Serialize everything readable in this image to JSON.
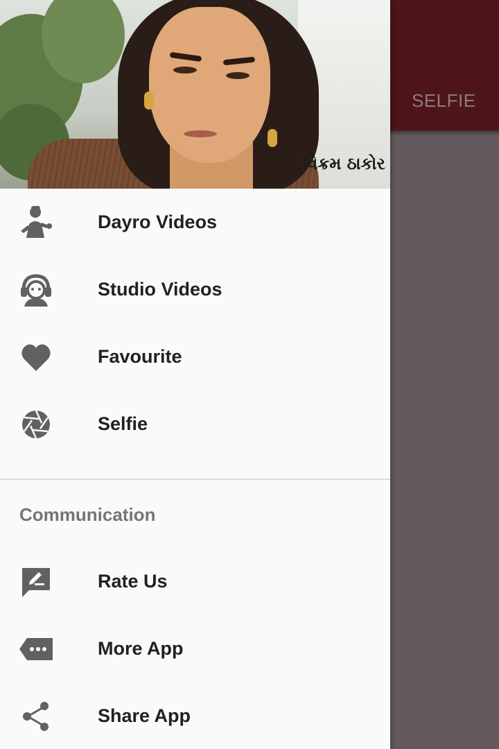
{
  "background_app": {
    "tab_label": "SELFIE",
    "toolbar_color": "#4d151a",
    "scrim_color": "#645a5d"
  },
  "drawer": {
    "header": {
      "caption": "વિક્રમ ઠાકોર"
    },
    "primary_items": [
      {
        "label": "Dayro Videos",
        "icon": "singer-icon"
      },
      {
        "label": "Studio Videos",
        "icon": "headset-person-icon"
      },
      {
        "label": "Favourite",
        "icon": "heart-icon"
      },
      {
        "label": "Selfie",
        "icon": "camera-shutter-icon"
      }
    ],
    "section_title": "Communication",
    "secondary_items": [
      {
        "label": "Rate Us",
        "icon": "rate-feedback-icon"
      },
      {
        "label": "More App",
        "icon": "more-tag-icon"
      },
      {
        "label": "Share App",
        "icon": "share-icon"
      }
    ],
    "icon_color": "#616161"
  }
}
